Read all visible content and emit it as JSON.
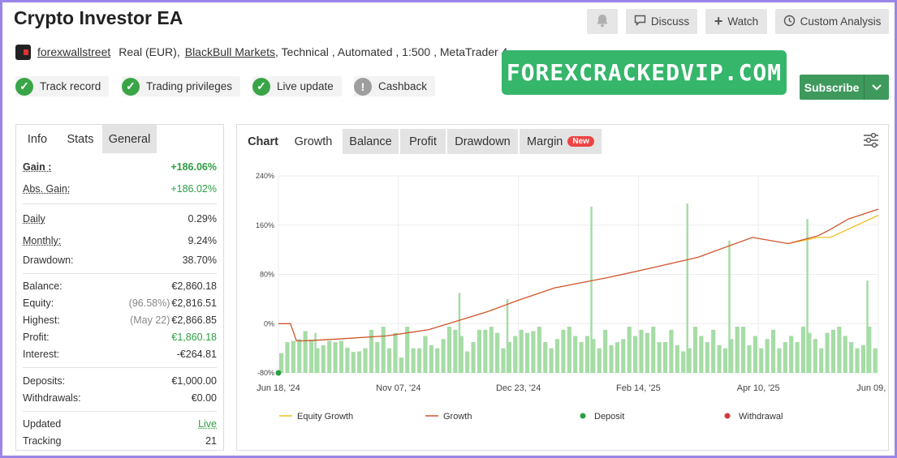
{
  "header": {
    "title": "Crypto Investor EA",
    "buttons": {
      "discuss": "Discuss",
      "watch": "Watch",
      "custom_analysis": "Custom Analysis"
    }
  },
  "meta": {
    "user": "forexwallstreet",
    "account": "Real (EUR),",
    "broker": "BlackBull Markets",
    "details": ", Technical , Automated , 1:500 , MetaTrader 4"
  },
  "badges": [
    "Track record",
    "Trading privileges",
    "Live update",
    "Cashback"
  ],
  "watermark": "FOREXCRACKEDVIP.COM",
  "subscribe": "Subscribe",
  "left_tabs": [
    "Info",
    "Stats",
    "General"
  ],
  "stats": {
    "gain": {
      "label": "Gain :",
      "value": "+186.06%"
    },
    "abs_gain": {
      "label": "Abs. Gain:",
      "value": "+186.02%"
    },
    "daily": {
      "label": "Daily",
      "value": "0.29%"
    },
    "monthly": {
      "label": "Monthly:",
      "value": "9.24%"
    },
    "drawdown": {
      "label": "Drawdown:",
      "value": "38.70%"
    },
    "balance": {
      "label": "Balance:",
      "value": "€2,860.18"
    },
    "equity": {
      "label": "Equity:",
      "note": "(96.58%)",
      "value": "€2,816.51"
    },
    "highest": {
      "label": "Highest:",
      "note": "(May 22)",
      "value": "€2,866.85"
    },
    "profit": {
      "label": "Profit:",
      "value": "€1,860.18"
    },
    "interest": {
      "label": "Interest:",
      "value": "-€264.81"
    },
    "deposits": {
      "label": "Deposits:",
      "value": "€1,000.00"
    },
    "withdrawals": {
      "label": "Withdrawals:",
      "value": "€0.00"
    },
    "updated": {
      "label": "Updated",
      "value": "Live"
    },
    "tracking": {
      "label": "Tracking",
      "value": "21"
    }
  },
  "chart_tabs": [
    "Chart",
    "Growth",
    "Balance",
    "Profit",
    "Drawdown",
    "Margin"
  ],
  "new_badge": "New",
  "colors": {
    "equity": "#f0c020",
    "growth": "#d0542a",
    "bars": "#a6dca6",
    "deposit": "#2e9e45",
    "withdrawal": "#d33a3a",
    "accent": "#3e9a5c"
  },
  "chart_data": {
    "type": "line",
    "y_tick_labels": [
      "240%",
      "160%",
      "80%",
      "0%",
      "-80%"
    ],
    "ylim": [
      -80,
      240
    ],
    "x_tick_labels": [
      "Jun 18, '24",
      "Nov 07, '24",
      "Dec 23, '24",
      "Feb 14, '25",
      "Apr 10, '25",
      "Jun 09, '25"
    ],
    "legend": [
      "Equity Growth",
      "Growth",
      "Deposit",
      "Withdrawal"
    ],
    "series": [
      {
        "name": "Growth",
        "x": [
          0,
          2,
          3,
          4,
          6,
          10,
          18,
          25,
          30,
          35,
          40,
          46,
          55,
          62,
          70,
          79,
          85,
          90,
          92,
          95,
          100
        ],
        "values": [
          0,
          0,
          -28,
          -28,
          -27,
          -25,
          -20,
          -10,
          5,
          20,
          38,
          58,
          75,
          90,
          108,
          140,
          130,
          143,
          153,
          170,
          186
        ]
      },
      {
        "name": "Equity Growth",
        "x": [
          85,
          90,
          92,
          100
        ],
        "values": [
          130,
          140,
          140,
          176
        ]
      }
    ],
    "bars": [
      -48,
      -30,
      -28,
      -25,
      -12,
      -26,
      -40,
      -35,
      -28,
      -30,
      -28,
      -39,
      -46,
      -45,
      -40,
      -10,
      -30,
      -5,
      -40,
      -15,
      -55,
      -5,
      -40,
      -40,
      -20,
      -35,
      -40,
      -25,
      -5,
      -10,
      -20,
      -45,
      -30,
      -10,
      -10,
      -5,
      -15,
      -40,
      -30,
      -20,
      -10,
      -15,
      -12,
      -5,
      -30,
      -40,
      -25,
      -10,
      -5,
      -20,
      -30,
      -20,
      -25,
      -40,
      -10,
      -35,
      -30,
      -25,
      -5,
      -20,
      -10,
      -15,
      -5,
      -30,
      -30,
      -10,
      -35,
      -45,
      -40,
      -5,
      -20,
      -30,
      -10,
      -35,
      -40,
      -25,
      -5,
      -5,
      -35,
      -20,
      -40,
      -25,
      -10,
      -40,
      -30,
      -20,
      -30,
      -5,
      -15,
      -25,
      -40,
      -15,
      -10,
      -5,
      -20,
      -30,
      -40,
      -35,
      -5,
      -40
    ]
  }
}
